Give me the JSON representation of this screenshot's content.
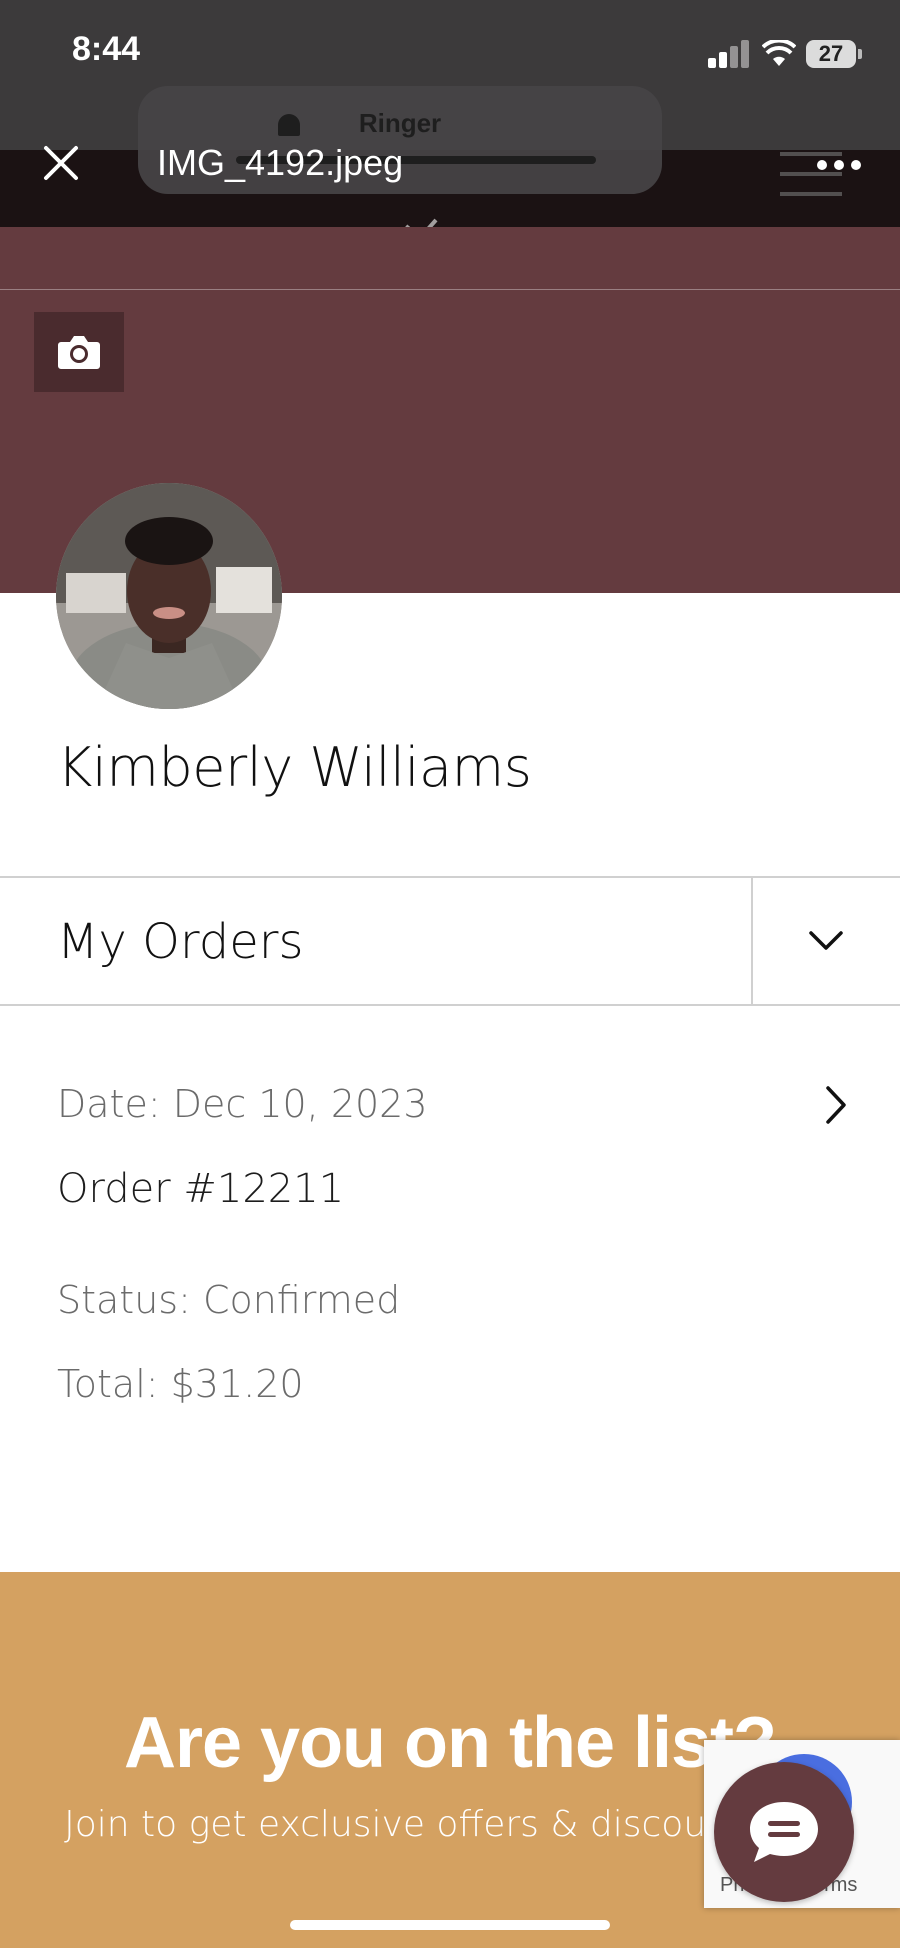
{
  "status_bar": {
    "time": "8:44",
    "battery": "27"
  },
  "ringer_overlay": {
    "label": "Ringer"
  },
  "viewer": {
    "file_name": "IMG_4192.jpeg"
  },
  "profile": {
    "name": "Kimberly Williams"
  },
  "orders": {
    "section_label": "My Orders",
    "items": [
      {
        "date": "Date: Dec 10, 2023",
        "number": "Order #12211",
        "status": "Status: Confirmed",
        "total": "Total: $31.20"
      }
    ]
  },
  "newsletter": {
    "heading": "Are you on the list?",
    "subtext": "Join to get exclusive offers & discounts"
  },
  "recaptcha": {
    "text": "Privacy - Terms"
  },
  "colors": {
    "hero": "#643b3f",
    "newsletter": "#d4a161",
    "chat_button": "#643b3f"
  },
  "icons": [
    "close-icon",
    "more-icon",
    "camera-icon",
    "chevron-down-icon",
    "chevron-right-icon",
    "chat-icon"
  ]
}
